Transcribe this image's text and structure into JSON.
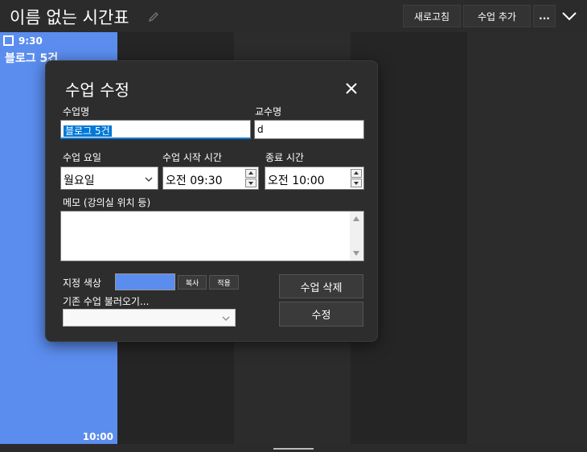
{
  "header": {
    "title": "이름 없는 시간표",
    "refresh_label": "새로고침",
    "add_class_label": "수업 추가",
    "more_label": "..."
  },
  "event": {
    "start_time": "9:30",
    "title": "블로그 5건",
    "end_time": "10:00",
    "color": "#5b8def"
  },
  "dialog": {
    "title": "수업 수정",
    "class_name_label": "수업명",
    "class_name_value": "블로그 5건",
    "professor_label": "교수명",
    "professor_value": "d",
    "day_label": "수업 요일",
    "day_value": "월요일",
    "start_label": "수업 시작 시간",
    "start_value": "오전 09:30",
    "end_label": "종료 시간",
    "end_value": "오전 10:00",
    "memo_label": "메모 (강의실 위치 등)",
    "memo_value": "",
    "color_label": "지정 색상",
    "color_value": "#5b8def",
    "copy_label": "복사",
    "apply_label": "적용",
    "import_label": "기존 수업 불러오기...",
    "import_value": "",
    "delete_label": "수업 삭제",
    "save_label": "수정"
  }
}
